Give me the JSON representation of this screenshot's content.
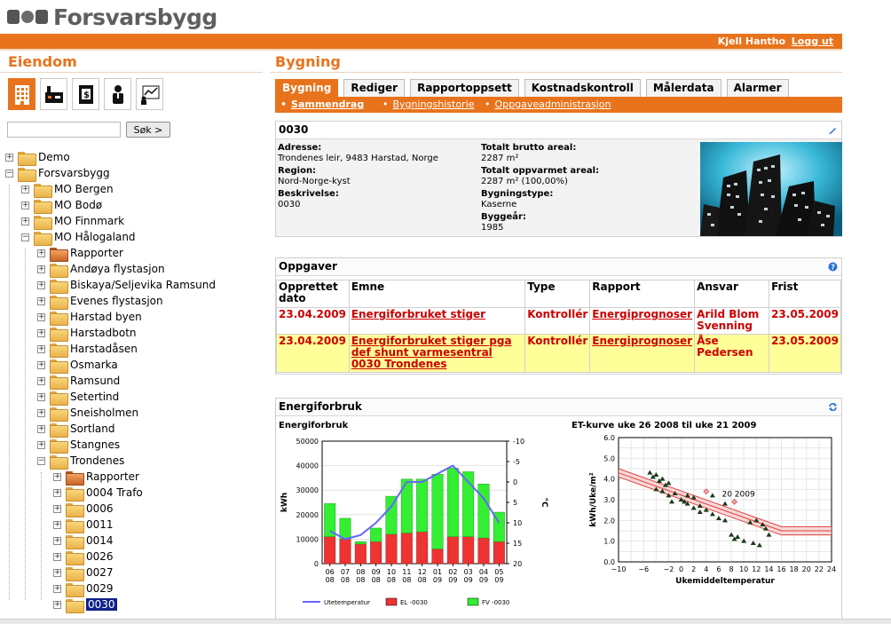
{
  "brand": {
    "name": "Forsvarsbygg"
  },
  "topbar": {
    "user": "Kjell Hantho",
    "logout": "Logg ut",
    "accent": "#e8731c"
  },
  "left": {
    "title": "Eiendom",
    "icons": [
      "building-icon",
      "factory-icon",
      "finance-building-icon",
      "person-icon",
      "chart-person-icon"
    ],
    "search": {
      "value": "",
      "button": "Søk >"
    },
    "tree": [
      {
        "label": "Demo",
        "level": 0,
        "exp": "+"
      },
      {
        "label": "Forsvarsbygg",
        "level": 0,
        "exp": "−"
      },
      {
        "label": "MO Bergen",
        "level": 1,
        "exp": "+"
      },
      {
        "label": "MO Bodø",
        "level": 1,
        "exp": "+"
      },
      {
        "label": "MO Finnmark",
        "level": 1,
        "exp": "+"
      },
      {
        "label": "MO Hålogaland",
        "level": 1,
        "exp": "−"
      },
      {
        "label": "Rapporter",
        "level": 2,
        "exp": "+",
        "red": true
      },
      {
        "label": "Andøya flystasjon",
        "level": 2,
        "exp": "+"
      },
      {
        "label": "Biskaya/Seljevika Ramsund",
        "level": 2,
        "exp": "+"
      },
      {
        "label": "Evenes flystasjon",
        "level": 2,
        "exp": "+"
      },
      {
        "label": "Harstad byen",
        "level": 2,
        "exp": "+"
      },
      {
        "label": "Harstadbotn",
        "level": 2,
        "exp": "+"
      },
      {
        "label": "Harstadåsen",
        "level": 2,
        "exp": "+"
      },
      {
        "label": "Osmarka",
        "level": 2,
        "exp": "+"
      },
      {
        "label": "Ramsund",
        "level": 2,
        "exp": "+"
      },
      {
        "label": "Setertind",
        "level": 2,
        "exp": "+"
      },
      {
        "label": "Sneisholmen",
        "level": 2,
        "exp": "+"
      },
      {
        "label": "Sortland",
        "level": 2,
        "exp": "+"
      },
      {
        "label": "Stangnes",
        "level": 2,
        "exp": "+"
      },
      {
        "label": "Trondenes",
        "level": 2,
        "exp": "−"
      },
      {
        "label": "Rapporter",
        "level": 3,
        "exp": "+",
        "red": true
      },
      {
        "label": "0004 Trafo",
        "level": 3,
        "exp": "+"
      },
      {
        "label": "0006",
        "level": 3,
        "exp": "+"
      },
      {
        "label": "0011",
        "level": 3,
        "exp": "+"
      },
      {
        "label": "0014",
        "level": 3,
        "exp": "+"
      },
      {
        "label": "0026",
        "level": 3,
        "exp": "+"
      },
      {
        "label": "0027",
        "level": 3,
        "exp": "+"
      },
      {
        "label": "0029",
        "level": 3,
        "exp": "+"
      },
      {
        "label": "0030",
        "level": 3,
        "exp": "+",
        "selected": true
      }
    ]
  },
  "right": {
    "title": "Bygning",
    "tabs": [
      "Bygning",
      "Rediger",
      "Rapportoppsett",
      "Kostnadskontroll",
      "Målerdata",
      "Alarmer"
    ],
    "subtabs": [
      "Sammendrag",
      "Bygningshistorie",
      "Oppgaveadministrasjon"
    ],
    "building": {
      "id": "0030",
      "address_label": "Adresse:",
      "address": "Trondenes leir, 9483 Harstad, Norge",
      "region_label": "Region:",
      "region": "Nord-Norge-kyst",
      "desc_label": "Beskrivelse:",
      "desc": "0030",
      "gross_label": "Totalt brutto areal:",
      "gross": "2287 m²",
      "heated_label": "Totalt oppvarmet areal:",
      "heated": "2287 m² (100,00%)",
      "type_label": "Bygningstype:",
      "type": "Kaserne",
      "year_label": "Byggeår:",
      "year": "1985"
    },
    "tasks": {
      "title": "Oppgaver",
      "headers": [
        "Opprettet dato",
        "Emne",
        "Type",
        "Rapport",
        "Ansvar",
        "Frist"
      ],
      "rows": [
        [
          "23.04.2009",
          "Energiforbruket stiger",
          "Kontrollér",
          "Energiprognoser",
          "Arild Blom Svenning",
          "23.05.2009"
        ],
        [
          "23.04.2009",
          "Energiforbruket stiger pga def shunt varmesentral 0030 Trondenes",
          "Kontrollér",
          "Energiprognoser",
          "Åse Pedersen",
          "23.05.2009"
        ]
      ]
    },
    "energy": {
      "title": "Energiforbruk"
    }
  },
  "chart_data": [
    {
      "type": "bar",
      "title": "Energiforbruk",
      "categories": [
        "06\n08",
        "07\n08",
        "08\n08",
        "09\n08",
        "10\n08",
        "11\n08",
        "12\n08",
        "01\n09",
        "02\n09",
        "03\n09",
        "04\n09",
        "05\n09"
      ],
      "ylabel": "kWh",
      "y2label": "°C",
      "ylim": [
        0,
        50000
      ],
      "y2lim": [
        20,
        -10
      ],
      "yticks": [
        0,
        10000,
        20000,
        30000,
        40000,
        50000
      ],
      "y2ticks": [
        -10,
        -5,
        0,
        5,
        10,
        15,
        20
      ],
      "stacked": true,
      "series": [
        {
          "name": "EL -0030",
          "color": "#ee3333",
          "values": [
            11000,
            10000,
            8000,
            9000,
            12000,
            12500,
            13000,
            6000,
            11000,
            11000,
            10500,
            9000
          ]
        },
        {
          "name": "FV -0030",
          "color": "#33ee33",
          "values": [
            13500,
            8500,
            1000,
            5500,
            15500,
            22000,
            21500,
            30500,
            28000,
            26500,
            22000,
            12000
          ]
        },
        {
          "name": "Utetemperatur",
          "color": "#6666ff",
          "line": true,
          "values": [
            12,
            14,
            13,
            10,
            6,
            0,
            0,
            -2,
            -4,
            0,
            4,
            10
          ]
        }
      ],
      "legend": "bottom"
    },
    {
      "type": "scatter",
      "title": "ET-kurve uke 26 2008 til uke 21 2009",
      "xlabel": "Ukemiddeltemperatur",
      "ylabel": "kWh/Uke/m²",
      "xlim": [
        -10,
        24
      ],
      "ylim": [
        0,
        6
      ],
      "xticks": [
        -10,
        -8,
        -6,
        -4,
        -2,
        0,
        2,
        4,
        6,
        8,
        10,
        12,
        14,
        16,
        18,
        20,
        22,
        24
      ],
      "yticks": [
        0,
        0.5,
        1,
        1.5,
        2,
        2.5,
        3,
        3.5,
        4,
        4.5,
        5,
        5.5,
        6
      ],
      "xtick_labels": [
        "−10",
        "",
        "−6",
        "",
        "−2",
        "0",
        "2",
        "4",
        "6",
        "8",
        "10",
        "12",
        "14",
        "16",
        "18",
        "20",
        "22",
        "24"
      ],
      "ytick_labels": [
        "0.0",
        "",
        "1.0",
        "",
        "2.0",
        "",
        "3.0",
        "",
        "4.0",
        "",
        "5.0",
        "",
        "6.0"
      ],
      "annotation": "20 2009",
      "points": [
        [
          -5,
          4.3
        ],
        [
          -4.5,
          4.1
        ],
        [
          -4,
          4.2
        ],
        [
          -3.5,
          3.9
        ],
        [
          -3,
          4.0
        ],
        [
          -2.5,
          3.7
        ],
        [
          -2,
          3.8
        ],
        [
          -3,
          3.4
        ],
        [
          -2,
          3.2
        ],
        [
          -1,
          3.3
        ],
        [
          0,
          3.0
        ],
        [
          1,
          3.2
        ],
        [
          2,
          3.1
        ],
        [
          1,
          2.8
        ],
        [
          3,
          2.7
        ],
        [
          2,
          2.6
        ],
        [
          4,
          2.5
        ],
        [
          5,
          2.3
        ],
        [
          6,
          2.1
        ],
        [
          7,
          2.0
        ],
        [
          -4,
          3.5
        ],
        [
          -1.5,
          2.9
        ],
        [
          0.5,
          2.9
        ],
        [
          3,
          2.4
        ],
        [
          8,
          1.3
        ],
        [
          9,
          1.2
        ],
        [
          10,
          1.0
        ],
        [
          11,
          1.9
        ],
        [
          12,
          2.0
        ],
        [
          13,
          1.8
        ],
        [
          13.5,
          1.6
        ],
        [
          11.5,
          0.9
        ],
        [
          12.5,
          0.8
        ],
        [
          8.5,
          1.1
        ],
        [
          14,
          1.3
        ],
        [
          7,
          2.8
        ],
        [
          5,
          3.2
        ]
      ],
      "highlight_points": [
        [
          8.5,
          2.9
        ],
        [
          4,
          3.4
        ]
      ],
      "band": {
        "x": [
          -10,
          16,
          24
        ],
        "center": [
          4.3,
          1.5,
          1.5
        ],
        "half_width": 0.2
      }
    }
  ]
}
